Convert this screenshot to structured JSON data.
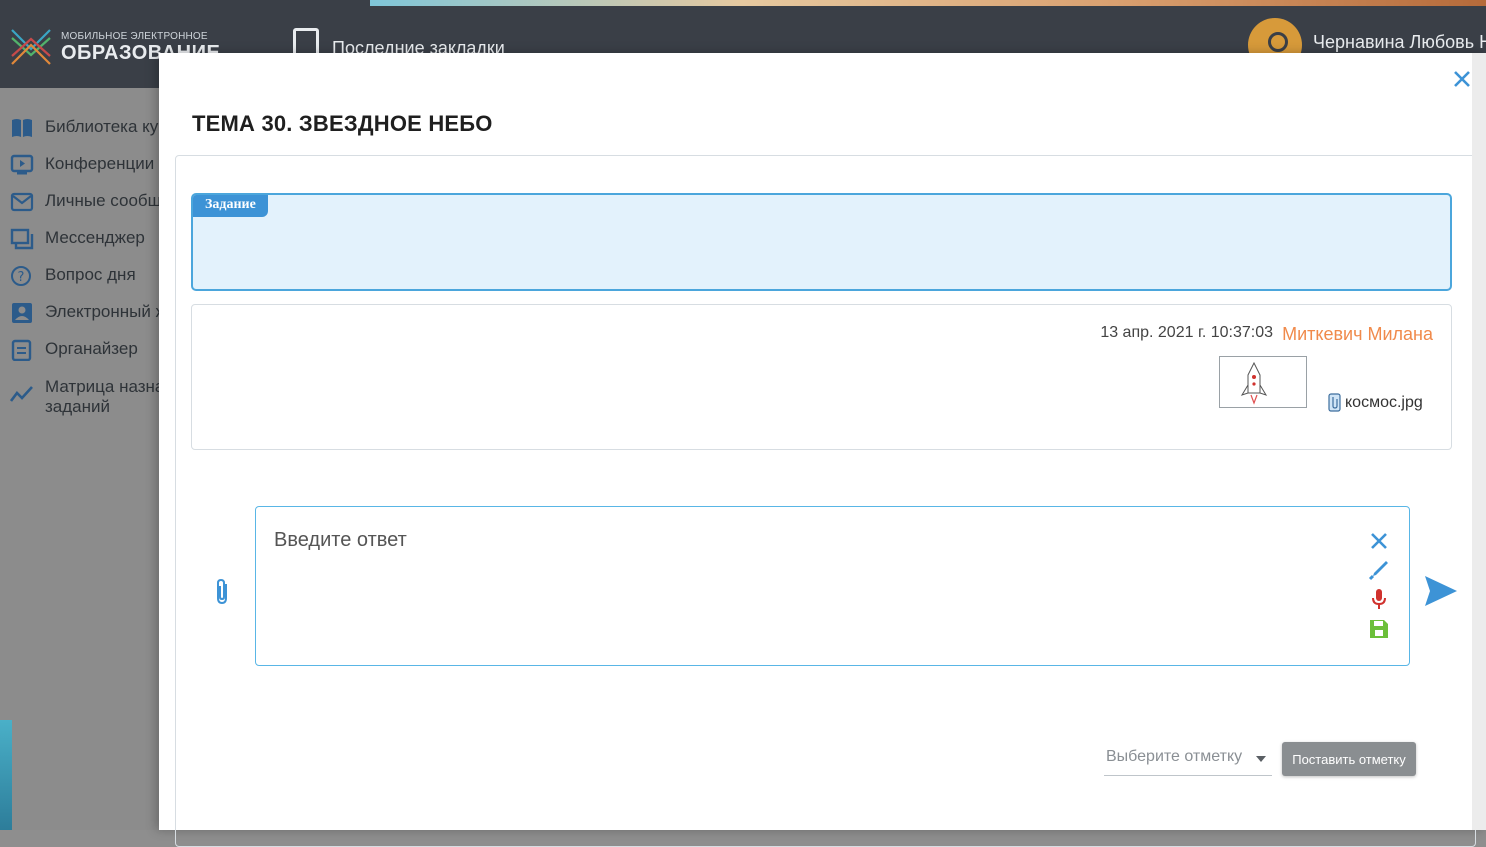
{
  "header": {
    "logo_small": "МОБИЛЬНОЕ ЭЛЕКТРОННОЕ",
    "logo_big": "ОБРАЗОВАНИЕ",
    "bookmarks_label": "Последние закладки",
    "user_name": "Чернавина Любовь Н"
  },
  "sidebar": {
    "items": [
      {
        "label": "Библиотека курсов",
        "icon": "book-icon"
      },
      {
        "label": "Конференции",
        "icon": "video-icon"
      },
      {
        "label": "Личные сообщения",
        "icon": "mail-icon"
      },
      {
        "label": "Мессенджер",
        "icon": "chat-icon"
      },
      {
        "label": "Вопрос дня",
        "icon": "question-icon"
      },
      {
        "label": "Электронный журнал",
        "icon": "contact-icon"
      },
      {
        "label": "Органайзер",
        "icon": "calendar-icon"
      },
      {
        "label": "Матрица назначенных",
        "label2": "заданий",
        "icon": "trend-icon"
      }
    ]
  },
  "modal": {
    "title": "ТЕМА 30. ЗВЕЗДНОЕ НЕБО",
    "task_badge": "Задание",
    "answer": {
      "date": "13 апр. 2021 г. 10:37:03",
      "author": "Миткевич Милана",
      "file_name": "космос.jpg"
    },
    "reply": {
      "placeholder": "Введите ответ"
    },
    "grade": {
      "select_placeholder": "Выберите отметку",
      "button_label": "Поставить отметку"
    }
  },
  "colors": {
    "accent_blue": "#3d93d6",
    "author_orange": "#f08a4b",
    "mic_red": "#d0322e",
    "save_green": "#6cbf3a"
  }
}
